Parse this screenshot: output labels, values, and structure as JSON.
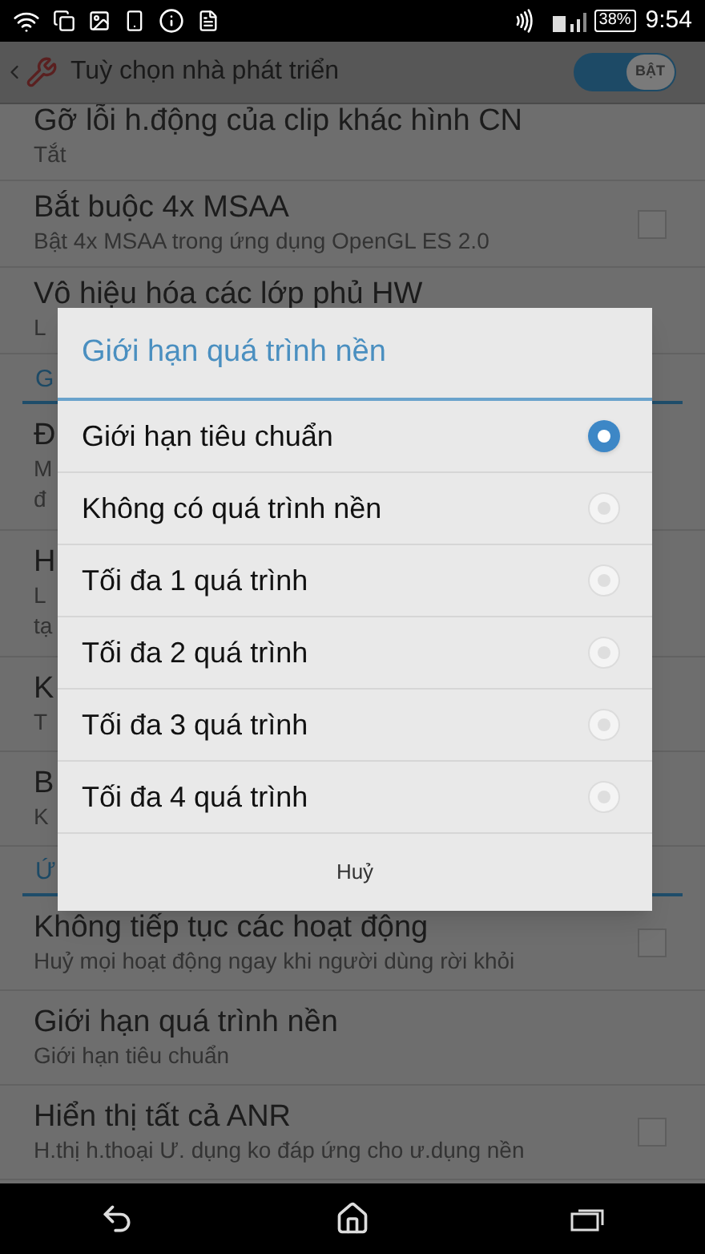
{
  "status_bar": {
    "battery": "38%",
    "time": "9:54"
  },
  "action_bar": {
    "title": "Tuỳ chọn nhà phát triển",
    "switch": {
      "label": "BẬT",
      "on": true
    }
  },
  "list": [
    {
      "kind": "clipped_item",
      "title": "Gỡ lỗi h.động của clip khác hình CN",
      "subtitle": "Tắt"
    },
    {
      "kind": "item",
      "title": "Bắt buộc 4x MSAA",
      "subtitle": "Bật 4x MSAA trong ứng dụng OpenGL ES 2.0",
      "checkbox": {
        "checked": false
      }
    },
    {
      "kind": "item",
      "title": "Vô hiệu hóa các lớp phủ HW",
      "subtitle": "L"
    },
    {
      "kind": "section",
      "title": "G"
    },
    {
      "kind": "item",
      "title": "Đ",
      "subtitle": "M",
      "subtitle_2": "đ"
    },
    {
      "kind": "item",
      "title": "H",
      "subtitle": "L",
      "subtitle_2": "tạ"
    },
    {
      "kind": "item",
      "title": "K",
      "subtitle": "T"
    },
    {
      "kind": "item",
      "title": "B",
      "subtitle": "K"
    },
    {
      "kind": "section",
      "title": "Ứ"
    },
    {
      "kind": "item",
      "title": "Không tiếp tục các hoạt động",
      "subtitle": "Huỷ mọi hoạt động ngay khi người dùng rời khỏi",
      "checkbox": {
        "checked": false
      }
    },
    {
      "kind": "item",
      "title": "Giới hạn quá trình nền",
      "subtitle": "Giới hạn tiêu chuẩn"
    },
    {
      "kind": "item",
      "title": "Hiển thị tất cả ANR",
      "subtitle": "H.thị h.thoại Ư. dụng ko đáp ứng cho ư.dụng nền",
      "checkbox": {
        "checked": false
      }
    }
  ],
  "dialog": {
    "title": "Giới hạn quá trình nền",
    "options": [
      {
        "label": "Giới hạn tiêu chuẩn",
        "selected": true
      },
      {
        "label": "Không có quá trình nền",
        "selected": false
      },
      {
        "label": "Tối đa 1 quá trình",
        "selected": false
      },
      {
        "label": "Tối đa 2 quá trình",
        "selected": false
      },
      {
        "label": "Tối đa 3 quá trình",
        "selected": false
      },
      {
        "label": "Tối đa 4 quá trình",
        "selected": false
      }
    ],
    "cancel": "Huỷ"
  }
}
